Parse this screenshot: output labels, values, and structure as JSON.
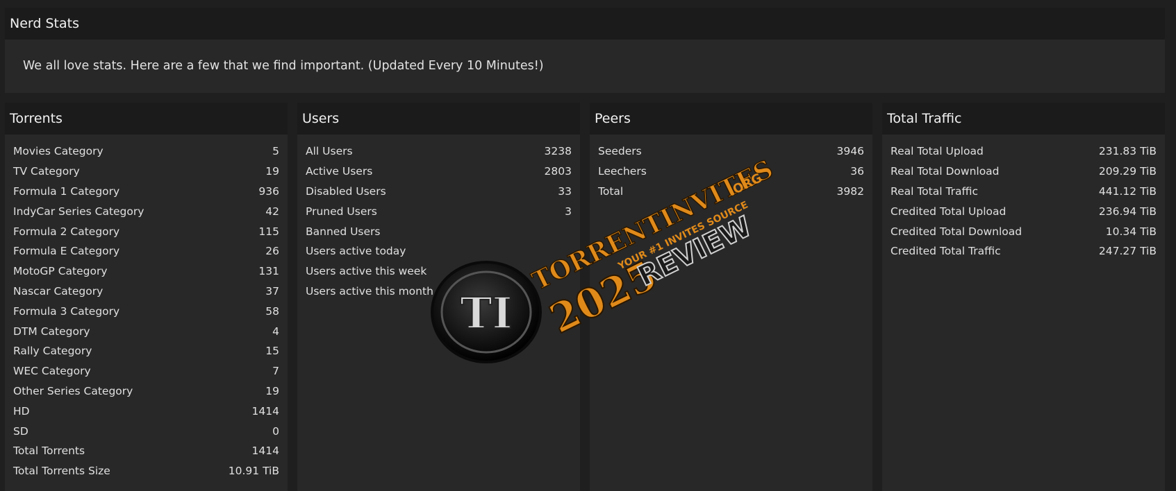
{
  "intro": {
    "title": "Nerd Stats",
    "text": "We all love stats. Here are a few that we find important. (Updated Every 10 Minutes!)"
  },
  "panels": [
    {
      "title": "Torrents",
      "rows": [
        {
          "label": "Movies Category",
          "value": "5"
        },
        {
          "label": "TV Category",
          "value": "19"
        },
        {
          "label": "Formula 1 Category",
          "value": "936"
        },
        {
          "label": "IndyCar Series Category",
          "value": "42"
        },
        {
          "label": "Formula 2 Category",
          "value": "115"
        },
        {
          "label": "Formula E Category",
          "value": "26"
        },
        {
          "label": "MotoGP Category",
          "value": "131"
        },
        {
          "label": "Nascar Category",
          "value": "37"
        },
        {
          "label": "Formula 3 Category",
          "value": "58"
        },
        {
          "label": "DTM Category",
          "value": "4"
        },
        {
          "label": "Rally Category",
          "value": "15"
        },
        {
          "label": "WEC Category",
          "value": "7"
        },
        {
          "label": "Other Series Category",
          "value": "19"
        },
        {
          "label": "HD",
          "value": "1414"
        },
        {
          "label": "SD",
          "value": "0"
        },
        {
          "label": "Total Torrents",
          "value": "1414"
        },
        {
          "label": "Total Torrents Size",
          "value": "10.91 TiB"
        }
      ]
    },
    {
      "title": "Users",
      "rows": [
        {
          "label": "All Users",
          "value": "3238"
        },
        {
          "label": "Active Users",
          "value": "2803"
        },
        {
          "label": "Disabled Users",
          "value": "33"
        },
        {
          "label": "Pruned Users",
          "value": "3"
        },
        {
          "label": "Banned Users",
          "value": ""
        },
        {
          "label": "Users active today",
          "value": ""
        },
        {
          "label": "Users active this week",
          "value": ""
        },
        {
          "label": "Users active this month",
          "value": ""
        }
      ]
    },
    {
      "title": "Peers",
      "rows": [
        {
          "label": "Seeders",
          "value": "3946"
        },
        {
          "label": "Leechers",
          "value": "36"
        },
        {
          "label": "Total",
          "value": "3982"
        }
      ]
    },
    {
      "title": "Total Traffic",
      "rows": [
        {
          "label": "Real Total Upload",
          "value": "231.83 TiB"
        },
        {
          "label": "Real Total Download",
          "value": "209.29 TiB"
        },
        {
          "label": "Real Total Traffic",
          "value": "441.12 TiB"
        },
        {
          "label": "Credited Total Upload",
          "value": "236.94 TiB"
        },
        {
          "label": "Credited Total Download",
          "value": "10.34 TiB"
        },
        {
          "label": "Credited Total Traffic",
          "value": "247.27 TiB"
        }
      ]
    }
  ],
  "watermark": {
    "logo_letters": "TI",
    "site": "TORRENTINVITES",
    "tld": ".ORG",
    "tagline": "YOUR #1 INVITES SOURCE",
    "year": "2025",
    "word": "REVIEW"
  },
  "colors": {
    "page_bg": "#1f1f1f",
    "panel_bg": "#282828",
    "header_bg": "#1b1b1b",
    "watermark_orange": "#e08a1a"
  }
}
